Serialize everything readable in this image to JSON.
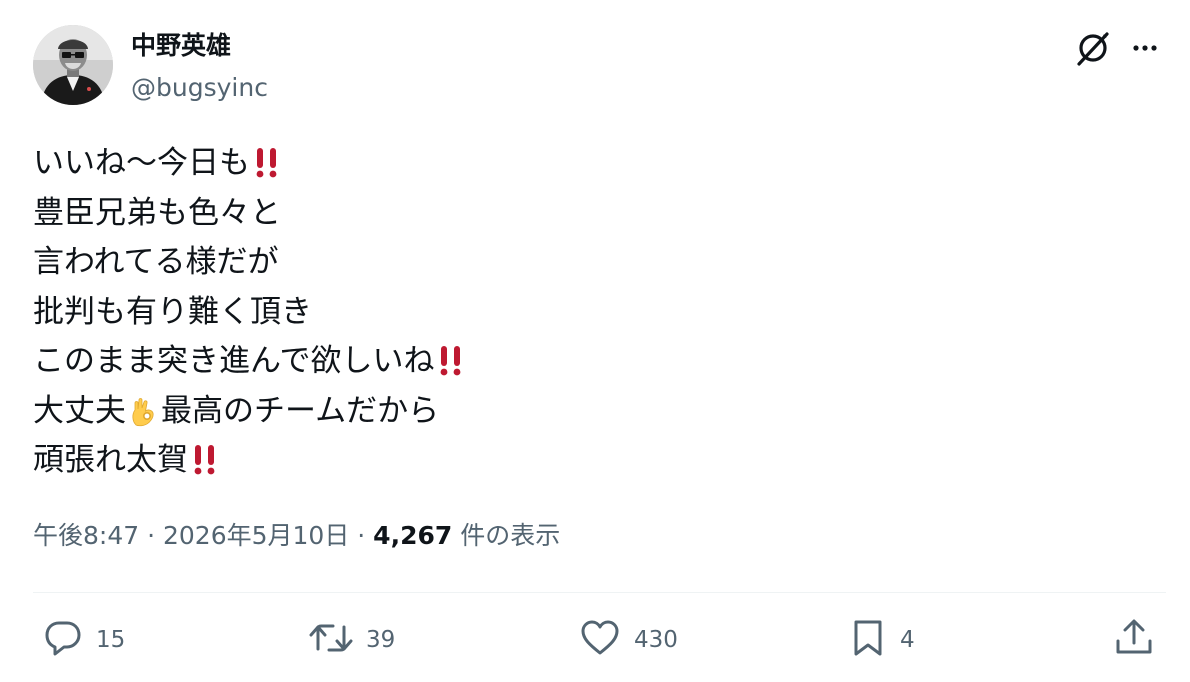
{
  "author": {
    "display_name": "中野英雄",
    "handle": "@bugsyinc",
    "avatar_icon": "avatar-photo"
  },
  "header_actions": {
    "grok_icon": "grok-icon",
    "more_icon": "more-icon"
  },
  "post": {
    "lines": [
      {
        "text": "いいね〜今日も",
        "suffix": "double-exclamation"
      },
      {
        "text": "豊臣兄弟も色々と",
        "suffix": ""
      },
      {
        "text": "言われてる様だが",
        "suffix": ""
      },
      {
        "text": "批判も有り難く頂き",
        "suffix": ""
      },
      {
        "text": "このまま突き進んで欲しいね",
        "suffix": "double-exclamation"
      },
      {
        "text_before": "大丈夫",
        "emoji": "ok-hand",
        "text_after": "最高のチームだから"
      },
      {
        "text": "頑張れ太賀",
        "suffix": "double-exclamation"
      }
    ]
  },
  "meta": {
    "time": "午後8:47",
    "separator": " · ",
    "date": "2026年5月10日",
    "views_count": "4,267",
    "views_label": " 件の表示"
  },
  "actions": {
    "reply": {
      "icon": "reply-icon",
      "count": "15"
    },
    "retweet": {
      "icon": "retweet-icon",
      "count": "39"
    },
    "like": {
      "icon": "heart-icon",
      "count": "430"
    },
    "bookmark": {
      "icon": "bookmark-icon",
      "count": "4"
    },
    "share": {
      "icon": "share-icon"
    }
  },
  "colors": {
    "text_primary": "#0f1419",
    "text_secondary": "#536471",
    "divider": "#eff3f4",
    "emoji_red": "#be1931",
    "emoji_yellow": "#ffcc4d"
  }
}
